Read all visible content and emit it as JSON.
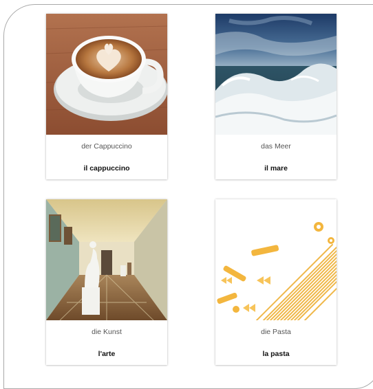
{
  "cards": [
    {
      "german": "der Cappuccino",
      "italian": "il cappuccino",
      "image": "cappuccino-cup-image"
    },
    {
      "german": "das Meer",
      "italian": "il mare",
      "image": "sea-waves-image"
    },
    {
      "german": "die Kunst",
      "italian": "l'arte",
      "image": "museum-gallery-image"
    },
    {
      "german": "die Pasta",
      "italian": "la pasta",
      "image": "dry-pasta-image"
    }
  ],
  "colors": {
    "frame_border": "#a9a9a9",
    "card_shadow": "#cccccc",
    "german_text": "#555555",
    "italian_text": "#111111"
  }
}
